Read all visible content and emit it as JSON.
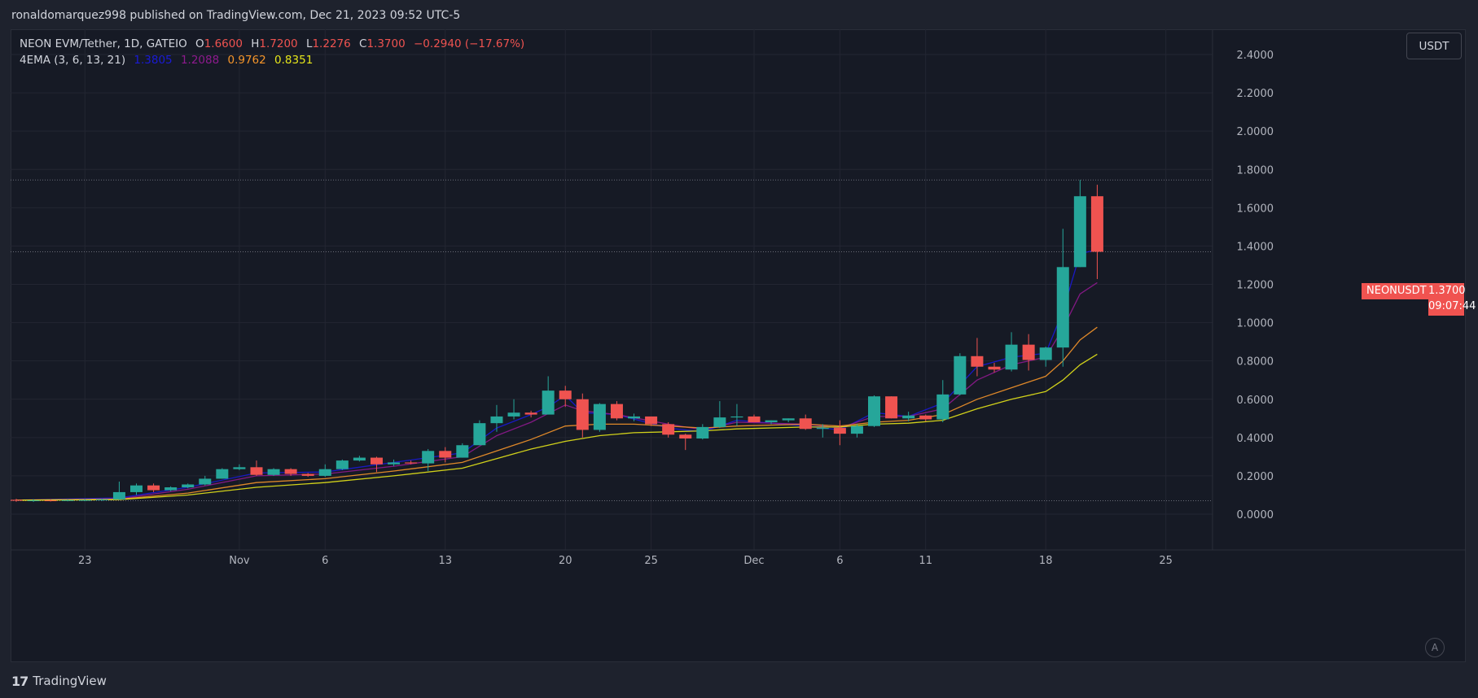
{
  "header": {
    "published_text": "ronaldomarquez998 published on TradingView.com, Dec 21, 2023 09:52 UTC-5"
  },
  "legend": {
    "symbol_line": "NEON EVM/Tether, 1D, GATEIO",
    "o_label": "O",
    "o_value": "1.6600",
    "h_label": "H",
    "h_value": "1.7200",
    "l_label": "L",
    "l_value": "1.2276",
    "c_label": "C",
    "c_value": "1.3700",
    "change": "−0.2940 (−17.67%)",
    "ema_label": "4EMA (3, 6, 13, 21)",
    "ema_values": [
      "1.3805",
      "1.2088",
      "0.9762",
      "0.8351"
    ],
    "ema_colors": [
      "#1a1ad6",
      "#8e1a8e",
      "#f5952a",
      "#e6e61a"
    ]
  },
  "currency_button": "USDT",
  "auto_button": "A",
  "price_tag": {
    "symbol": "NEONUSDT",
    "price": "1.3700",
    "countdown": "09:07:44"
  },
  "footer": {
    "brand": "TradingView",
    "logo": "17"
  },
  "colors": {
    "up": "#26a69a",
    "down": "#ef5350",
    "grid": "#232632",
    "background": "#161a25"
  },
  "chart_data": {
    "type": "candlestick",
    "y_axis_labels": [
      "2.4000",
      "2.2000",
      "2.0000",
      "1.8000",
      "1.6000",
      "1.4000",
      "1.2000",
      "1.0000",
      "0.8000",
      "0.6000",
      "0.4000",
      "0.2000",
      "0.0000"
    ],
    "ylim": [
      -0.15,
      2.4
    ],
    "x_axis_labels": [
      {
        "label": "23",
        "index": 4
      },
      {
        "label": "Nov",
        "index": 13
      },
      {
        "label": "6",
        "index": 18
      },
      {
        "label": "13",
        "index": 25
      },
      {
        "label": "20",
        "index": 32
      },
      {
        "label": "25",
        "index": 37
      },
      {
        "label": "Dec",
        "index": 43
      },
      {
        "label": "6",
        "index": 48
      },
      {
        "label": "11",
        "index": 53
      },
      {
        "label": "18",
        "index": 60
      },
      {
        "label": "25",
        "index": 67
      }
    ],
    "reference_lines": [
      1.745,
      1.37,
      0.07
    ],
    "candles": [
      {
        "o": 0.075,
        "h": 0.08,
        "l": 0.065,
        "c": 0.07
      },
      {
        "o": 0.07,
        "h": 0.078,
        "l": 0.064,
        "c": 0.072
      },
      {
        "o": 0.072,
        "h": 0.078,
        "l": 0.066,
        "c": 0.07
      },
      {
        "o": 0.07,
        "h": 0.076,
        "l": 0.067,
        "c": 0.073
      },
      {
        "o": 0.073,
        "h": 0.078,
        "l": 0.068,
        "c": 0.074
      },
      {
        "o": 0.074,
        "h": 0.08,
        "l": 0.069,
        "c": 0.077
      },
      {
        "o": 0.077,
        "h": 0.17,
        "l": 0.075,
        "c": 0.115
      },
      {
        "o": 0.115,
        "h": 0.16,
        "l": 0.1,
        "c": 0.15
      },
      {
        "o": 0.15,
        "h": 0.16,
        "l": 0.115,
        "c": 0.125
      },
      {
        "o": 0.125,
        "h": 0.145,
        "l": 0.12,
        "c": 0.14
      },
      {
        "o": 0.14,
        "h": 0.16,
        "l": 0.135,
        "c": 0.155
      },
      {
        "o": 0.155,
        "h": 0.2,
        "l": 0.15,
        "c": 0.185
      },
      {
        "o": 0.185,
        "h": 0.24,
        "l": 0.185,
        "c": 0.235
      },
      {
        "o": 0.235,
        "h": 0.26,
        "l": 0.23,
        "c": 0.245
      },
      {
        "o": 0.245,
        "h": 0.28,
        "l": 0.2,
        "c": 0.205
      },
      {
        "o": 0.205,
        "h": 0.24,
        "l": 0.2,
        "c": 0.235
      },
      {
        "o": 0.235,
        "h": 0.24,
        "l": 0.2,
        "c": 0.21
      },
      {
        "o": 0.21,
        "h": 0.215,
        "l": 0.195,
        "c": 0.2
      },
      {
        "o": 0.2,
        "h": 0.26,
        "l": 0.195,
        "c": 0.235
      },
      {
        "o": 0.235,
        "h": 0.285,
        "l": 0.23,
        "c": 0.28
      },
      {
        "o": 0.28,
        "h": 0.305,
        "l": 0.275,
        "c": 0.295
      },
      {
        "o": 0.295,
        "h": 0.3,
        "l": 0.22,
        "c": 0.26
      },
      {
        "o": 0.26,
        "h": 0.285,
        "l": 0.25,
        "c": 0.27
      },
      {
        "o": 0.27,
        "h": 0.28,
        "l": 0.26,
        "c": 0.265
      },
      {
        "o": 0.265,
        "h": 0.34,
        "l": 0.225,
        "c": 0.33
      },
      {
        "o": 0.33,
        "h": 0.35,
        "l": 0.27,
        "c": 0.295
      },
      {
        "o": 0.295,
        "h": 0.37,
        "l": 0.295,
        "c": 0.36
      },
      {
        "o": 0.36,
        "h": 0.49,
        "l": 0.36,
        "c": 0.475
      },
      {
        "o": 0.475,
        "h": 0.57,
        "l": 0.43,
        "c": 0.51
      },
      {
        "o": 0.51,
        "h": 0.6,
        "l": 0.495,
        "c": 0.53
      },
      {
        "o": 0.53,
        "h": 0.54,
        "l": 0.505,
        "c": 0.52
      },
      {
        "o": 0.52,
        "h": 0.72,
        "l": 0.52,
        "c": 0.645
      },
      {
        "o": 0.645,
        "h": 0.67,
        "l": 0.56,
        "c": 0.6
      },
      {
        "o": 0.6,
        "h": 0.63,
        "l": 0.4,
        "c": 0.44
      },
      {
        "o": 0.44,
        "h": 0.58,
        "l": 0.43,
        "c": 0.575
      },
      {
        "o": 0.575,
        "h": 0.59,
        "l": 0.49,
        "c": 0.5
      },
      {
        "o": 0.5,
        "h": 0.525,
        "l": 0.485,
        "c": 0.51
      },
      {
        "o": 0.51,
        "h": 0.51,
        "l": 0.46,
        "c": 0.47
      },
      {
        "o": 0.47,
        "h": 0.48,
        "l": 0.4,
        "c": 0.415
      },
      {
        "o": 0.415,
        "h": 0.42,
        "l": 0.335,
        "c": 0.395
      },
      {
        "o": 0.395,
        "h": 0.47,
        "l": 0.39,
        "c": 0.455
      },
      {
        "o": 0.455,
        "h": 0.59,
        "l": 0.45,
        "c": 0.505
      },
      {
        "o": 0.505,
        "h": 0.575,
        "l": 0.46,
        "c": 0.51
      },
      {
        "o": 0.51,
        "h": 0.52,
        "l": 0.48,
        "c": 0.48
      },
      {
        "o": 0.48,
        "h": 0.49,
        "l": 0.47,
        "c": 0.49
      },
      {
        "o": 0.49,
        "h": 0.5,
        "l": 0.48,
        "c": 0.5
      },
      {
        "o": 0.5,
        "h": 0.52,
        "l": 0.44,
        "c": 0.445
      },
      {
        "o": 0.445,
        "h": 0.47,
        "l": 0.4,
        "c": 0.45
      },
      {
        "o": 0.45,
        "h": 0.49,
        "l": 0.36,
        "c": 0.42
      },
      {
        "o": 0.42,
        "h": 0.47,
        "l": 0.4,
        "c": 0.46
      },
      {
        "o": 0.46,
        "h": 0.62,
        "l": 0.455,
        "c": 0.615
      },
      {
        "o": 0.615,
        "h": 0.615,
        "l": 0.5,
        "c": 0.5
      },
      {
        "o": 0.5,
        "h": 0.535,
        "l": 0.485,
        "c": 0.515
      },
      {
        "o": 0.515,
        "h": 0.52,
        "l": 0.485,
        "c": 0.495
      },
      {
        "o": 0.495,
        "h": 0.7,
        "l": 0.48,
        "c": 0.625
      },
      {
        "o": 0.625,
        "h": 0.84,
        "l": 0.62,
        "c": 0.825
      },
      {
        "o": 0.825,
        "h": 0.92,
        "l": 0.72,
        "c": 0.77
      },
      {
        "o": 0.77,
        "h": 0.79,
        "l": 0.74,
        "c": 0.755
      },
      {
        "o": 0.755,
        "h": 0.95,
        "l": 0.745,
        "c": 0.885
      },
      {
        "o": 0.885,
        "h": 0.94,
        "l": 0.75,
        "c": 0.805
      },
      {
        "o": 0.805,
        "h": 0.875,
        "l": 0.77,
        "c": 0.87
      },
      {
        "o": 0.87,
        "h": 1.49,
        "l": 0.77,
        "c": 1.29
      },
      {
        "o": 1.29,
        "h": 1.745,
        "l": 1.29,
        "c": 1.66
      },
      {
        "o": 1.66,
        "h": 1.72,
        "l": 1.2276,
        "c": 1.37
      }
    ],
    "ema_series": [
      {
        "period": 3,
        "color": "#1a1ad6",
        "values": [
          [
            0,
            0.073
          ],
          [
            6,
            0.085
          ],
          [
            10,
            0.14
          ],
          [
            14,
            0.215
          ],
          [
            18,
            0.22
          ],
          [
            22,
            0.27
          ],
          [
            26,
            0.32
          ],
          [
            28,
            0.45
          ],
          [
            30,
            0.52
          ],
          [
            31,
            0.56
          ],
          [
            32,
            0.62
          ],
          [
            33,
            0.53
          ],
          [
            35,
            0.52
          ],
          [
            38,
            0.45
          ],
          [
            40,
            0.43
          ],
          [
            42,
            0.49
          ],
          [
            46,
            0.46
          ],
          [
            48,
            0.44
          ],
          [
            50,
            0.53
          ],
          [
            52,
            0.51
          ],
          [
            54,
            0.58
          ],
          [
            56,
            0.77
          ],
          [
            58,
            0.82
          ],
          [
            60,
            0.84
          ],
          [
            61,
            1.06
          ],
          [
            62,
            1.36
          ],
          [
            63,
            1.3805
          ]
        ]
      },
      {
        "period": 6,
        "color": "#8e1a8e",
        "values": [
          [
            0,
            0.073
          ],
          [
            6,
            0.08
          ],
          [
            10,
            0.13
          ],
          [
            14,
            0.2
          ],
          [
            18,
            0.21
          ],
          [
            22,
            0.25
          ],
          [
            26,
            0.3
          ],
          [
            28,
            0.41
          ],
          [
            30,
            0.48
          ],
          [
            32,
            0.57
          ],
          [
            33,
            0.54
          ],
          [
            35,
            0.52
          ],
          [
            38,
            0.47
          ],
          [
            40,
            0.44
          ],
          [
            42,
            0.48
          ],
          [
            46,
            0.47
          ],
          [
            48,
            0.45
          ],
          [
            50,
            0.51
          ],
          [
            52,
            0.51
          ],
          [
            54,
            0.55
          ],
          [
            56,
            0.7
          ],
          [
            58,
            0.78
          ],
          [
            60,
            0.82
          ],
          [
            61,
            0.97
          ],
          [
            62,
            1.15
          ],
          [
            63,
            1.2088
          ]
        ]
      },
      {
        "period": 13,
        "color": "#f5952a",
        "values": [
          [
            0,
            0.073
          ],
          [
            6,
            0.078
          ],
          [
            10,
            0.11
          ],
          [
            14,
            0.165
          ],
          [
            18,
            0.185
          ],
          [
            22,
            0.225
          ],
          [
            26,
            0.27
          ],
          [
            28,
            0.33
          ],
          [
            30,
            0.39
          ],
          [
            32,
            0.46
          ],
          [
            34,
            0.47
          ],
          [
            36,
            0.47
          ],
          [
            38,
            0.46
          ],
          [
            40,
            0.45
          ],
          [
            42,
            0.46
          ],
          [
            46,
            0.47
          ],
          [
            48,
            0.46
          ],
          [
            50,
            0.48
          ],
          [
            52,
            0.49
          ],
          [
            54,
            0.52
          ],
          [
            56,
            0.6
          ],
          [
            58,
            0.66
          ],
          [
            60,
            0.72
          ],
          [
            61,
            0.8
          ],
          [
            62,
            0.91
          ],
          [
            63,
            0.9762
          ]
        ]
      },
      {
        "period": 21,
        "color": "#e6e61a",
        "values": [
          [
            0,
            0.073
          ],
          [
            6,
            0.076
          ],
          [
            10,
            0.1
          ],
          [
            14,
            0.14
          ],
          [
            18,
            0.165
          ],
          [
            22,
            0.2
          ],
          [
            26,
            0.24
          ],
          [
            28,
            0.29
          ],
          [
            30,
            0.34
          ],
          [
            32,
            0.38
          ],
          [
            34,
            0.41
          ],
          [
            36,
            0.425
          ],
          [
            38,
            0.43
          ],
          [
            40,
            0.435
          ],
          [
            42,
            0.445
          ],
          [
            46,
            0.455
          ],
          [
            48,
            0.455
          ],
          [
            50,
            0.47
          ],
          [
            52,
            0.475
          ],
          [
            54,
            0.49
          ],
          [
            56,
            0.55
          ],
          [
            58,
            0.6
          ],
          [
            60,
            0.64
          ],
          [
            61,
            0.7
          ],
          [
            62,
            0.78
          ],
          [
            63,
            0.8351
          ]
        ]
      }
    ]
  }
}
